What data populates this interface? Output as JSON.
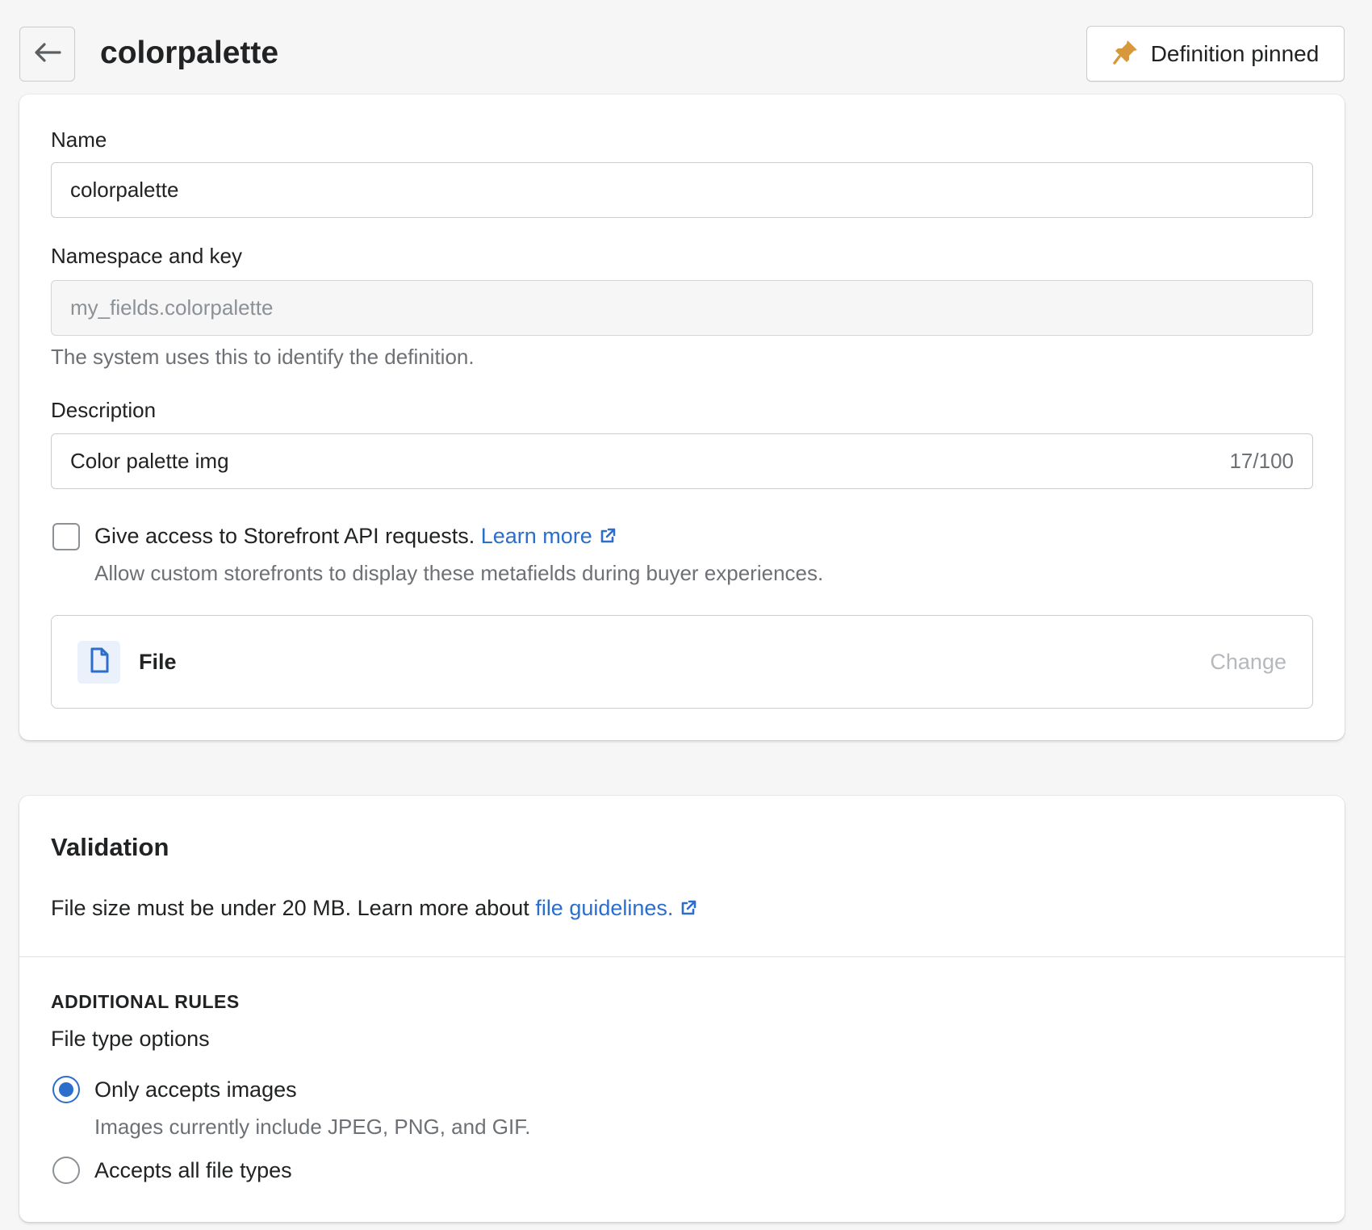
{
  "header": {
    "title": "colorpalette",
    "pin_button_label": "Definition pinned",
    "back_icon": "arrow-left-icon",
    "pin_icon": "pin-icon"
  },
  "definition": {
    "name_label": "Name",
    "name_value": "colorpalette",
    "namespace_label": "Namespace and key",
    "namespace_value": "my_fields.colorpalette",
    "namespace_help": "The system uses this to identify the definition.",
    "description_label": "Description",
    "description_value": "Color palette img",
    "description_counter": "17/100",
    "storefront_checkbox_label": "Give access to Storefront API requests.",
    "storefront_checkbox_checked": false,
    "storefront_link": "Learn more",
    "storefront_help": "Allow custom storefronts to display these metafields during buyer experiences.",
    "type_name": "File",
    "type_change_label": "Change",
    "type_icon": "file-icon"
  },
  "validation": {
    "heading": "Validation",
    "text": "File size must be under 20 MB. Learn more about ",
    "link": "file guidelines.",
    "rules_heading": "ADDITIONAL RULES",
    "options_label": "File type options",
    "options": [
      {
        "label": "Only accepts images",
        "help": "Images currently include JPEG, PNG, and GIF.",
        "selected": true
      },
      {
        "label": "Accepts all file types",
        "selected": false
      }
    ]
  },
  "colors": {
    "accent": "#2c6ecb",
    "pin": "#d6983a",
    "background": "#f6f6f7"
  }
}
